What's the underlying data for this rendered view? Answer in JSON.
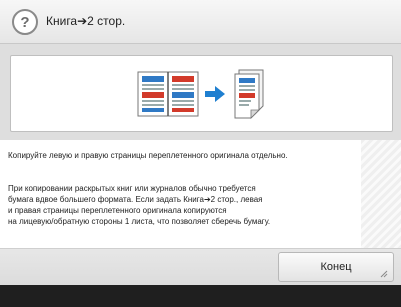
{
  "header": {
    "help_icon": "question-mark-icon",
    "title": "Книга➔2 стор."
  },
  "illustration": {
    "description_icons": [
      "open-book-icon",
      "arrow-right-icon",
      "two-page-stack-icon"
    ],
    "colors": {
      "blue": "#2f79c5",
      "red": "#d23a2a",
      "arrow": "#1f7fd0"
    }
  },
  "content": {
    "paragraph1": "Копируйте левую и правую страницы переплетенного оригинала отдельно.",
    "paragraph2_lines": [
      "При копировании раскрытых книг или журналов обычно требуется",
      "бумага вдвое большего формата. Если задать Книга➔2 стор., левая",
      "и правая страницы переплетенного оригинала копируются",
      "на лицевую/обратную стороны 1 листа, что позволяет сберечь бумагу."
    ]
  },
  "footer": {
    "done_label": "Конец"
  }
}
